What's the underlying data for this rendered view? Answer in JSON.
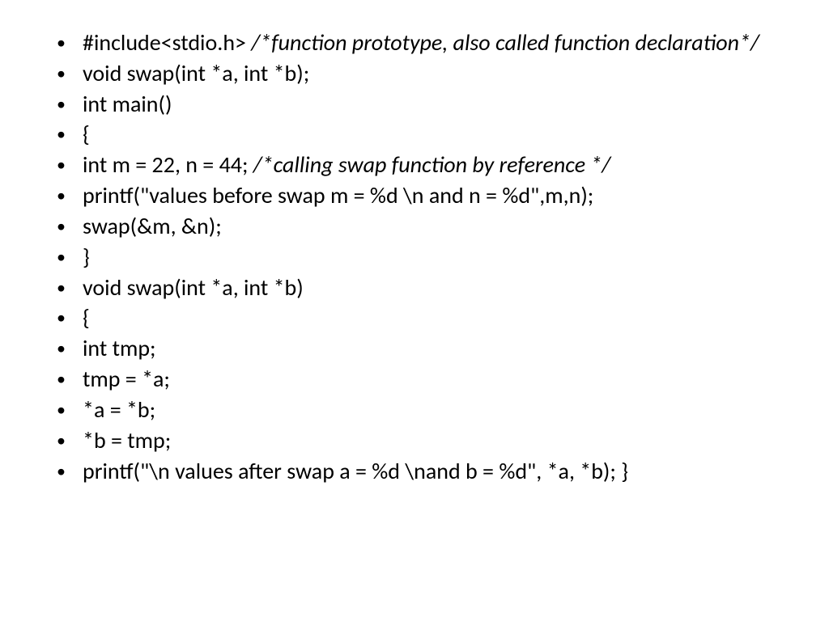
{
  "lines": [
    {
      "pre": "#include<stdio.h> ",
      "comment": "/*function prototype, also called function declaration*/"
    },
    {
      "pre": "void swap(int *a, int *b);"
    },
    {
      "pre": "int main()"
    },
    {
      "pre": "{"
    },
    {
      "pre": "  int m = 22, n = 44;  ",
      "comment": "/*calling swap function by reference */"
    },
    {
      "pre": "printf(\"values before swap m = %d \\n and n = %d\",m,n);"
    },
    {
      "pre": "swap(&m, &n);"
    },
    {
      "pre": "}"
    },
    {
      "pre": "void swap(int *a, int *b)"
    },
    {
      "pre": "{"
    },
    {
      "pre": "int tmp;"
    },
    {
      "pre": "tmp = *a;"
    },
    {
      "pre": "*a = *b;"
    },
    {
      "pre": "*b = tmp;"
    },
    {
      "pre": "printf(\"\\n values after swap a = %d \\nand b = %d\", *a, *b); }"
    }
  ]
}
